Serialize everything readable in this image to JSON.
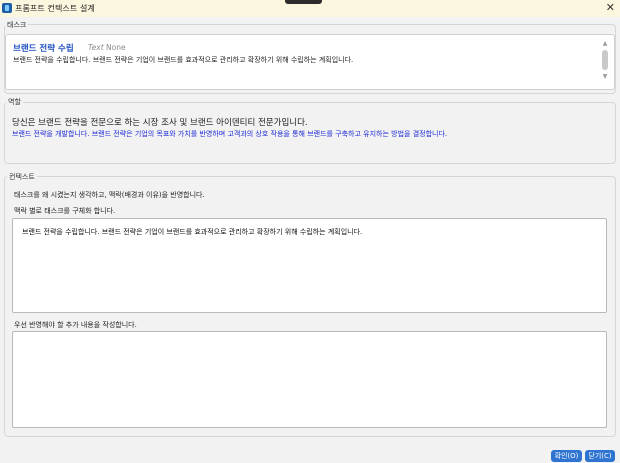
{
  "window": {
    "title": "프롬프트 컨텍스트 설계",
    "close_glyph": "✕"
  },
  "task": {
    "legend": "태스크",
    "title": "브랜드 전략 수립",
    "meta_italic": "Text",
    "meta_value": "None",
    "description": "브랜드 전략을 수립합니다. 브랜드 전략은 기업이 브랜드를 효과적으로 관리하고 확장하기 위해 수립하는 계획입니다."
  },
  "role": {
    "legend": "역할",
    "primary": "당신은 브랜드 전략을 전문으로 하는 시장 조사 및 브랜드 아이덴티티 전문가입니다.",
    "secondary": "브랜드 전략을 개발합니다. 브랜드 전략은 기업의 목표와 가치를 반영하며 고객과의 상호 작용을 통해 브랜드를 구축하고 유지하는 방법을 결정합니다."
  },
  "context": {
    "legend": "컨텍스트",
    "instruction_1": "태스크를 왜 시켰는지 생각하고, 맥락(배경과 이유)을 반영합니다.",
    "instruction_2": "맥락 별로 태스크를 구체화 합니다.",
    "context_value": "브랜드 전략을 수립합니다. 브랜드 전략은 기업이 브랜드를 효과적으로 관리하고 확장하기 위해 수립하는 계획입니다.",
    "extra_label": "우선 반영해야 할 추가 내용을 작성합니다.",
    "extra_value": ""
  },
  "buttons": {
    "confirm": "확인(O)",
    "close": "닫기(C)"
  },
  "colors": {
    "accent": "#2f74d0",
    "task_title": "#1f4fc2",
    "role_secondary": "#1d2ad6",
    "titlebar": "#fbf6de"
  },
  "icons": {
    "app": "app-icon",
    "close": "close-icon",
    "scroll_up": "chevron-up-icon",
    "scroll_down": "chevron-down-icon"
  }
}
